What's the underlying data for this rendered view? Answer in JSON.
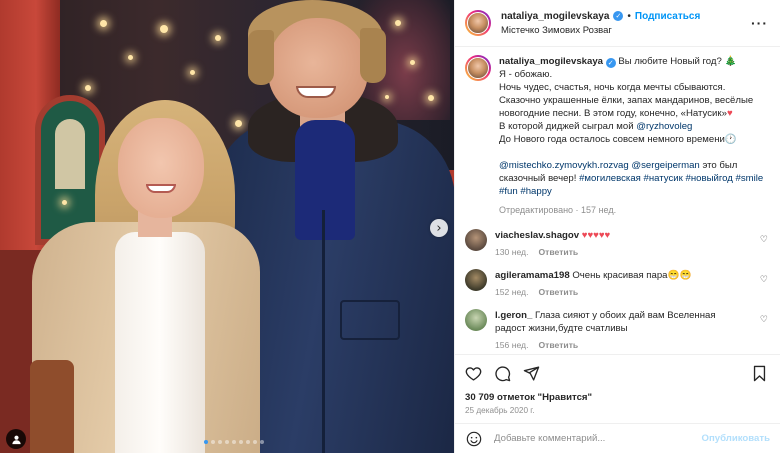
{
  "header": {
    "username": "nataliya_mogilevskaya",
    "separator": "•",
    "follow_label": "Подписаться",
    "location": "Містечко Зимових Розваг",
    "more_label": "···"
  },
  "caption": {
    "username": "nataliya_mogilevskaya",
    "lines": [
      "Вы любите Новый год?",
      "Я - обожаю.",
      "Ночь чудес, счастья, ночь когда мечты сбываются.",
      "Сказочно украшенные ёлки, запах мандаринов, весёлые",
      "новогодние песни. В этом году, конечно, «Натусик»",
      "В которой диджей сыграл мой",
      "До Нового года осталось совсем немного времени"
    ],
    "tree_emoji": "🎄",
    "heart": "♥",
    "clock": "🕐",
    "mention_1": "@ryzhovoleg",
    "mention_2": "@mistechko.zymovykh.rozvag",
    "mention_3": "@sergeiperman",
    "text_after_mentions": " это был",
    "text_evening": "сказочный вечер!",
    "hashtags": [
      "#могилевская",
      "#натусик",
      "#новыйгод",
      "#smile",
      "#fun",
      "#happy"
    ],
    "edited": "Отредактировано · 157 нед."
  },
  "comments": [
    {
      "username": "viacheslav.shagov",
      "text": "♥♥♥♥♥",
      "likes": "130 нед.",
      "reply": "Ответить",
      "avatar_color": "#5b4a3f"
    },
    {
      "username": "agileramama198",
      "text": "Очень красивая пара😁😁",
      "likes": "152 нед.",
      "reply": "Ответить",
      "avatar_color": "#3d3a2a"
    },
    {
      "username": "l.geron_",
      "text": "Глаза сияют у обоих дай вам Вселенная радост жизни,будте счатливы",
      "likes": "156 нед.",
      "reply": "Ответить",
      "avatar_color": "#6b8a5a"
    }
  ],
  "actions": {
    "like_icon": "heart-outline-icon",
    "comment_icon": "comment-icon",
    "share_icon": "paper-plane-icon",
    "save_icon": "bookmark-icon"
  },
  "likes_text": "30 709 отметок \"Нравится\"",
  "date": "25 декабрь 2020 г.",
  "add_comment": {
    "placeholder": "Добавьте комментарий...",
    "publish_label": "Опубликовать"
  },
  "media": {
    "next_arrow": "›",
    "carousel_count": 9,
    "carousel_active": 0
  },
  "colors": {
    "link": "#00376b",
    "follow": "#0095f6",
    "heart": "#ed4956",
    "muted": "#8e8e8e"
  }
}
